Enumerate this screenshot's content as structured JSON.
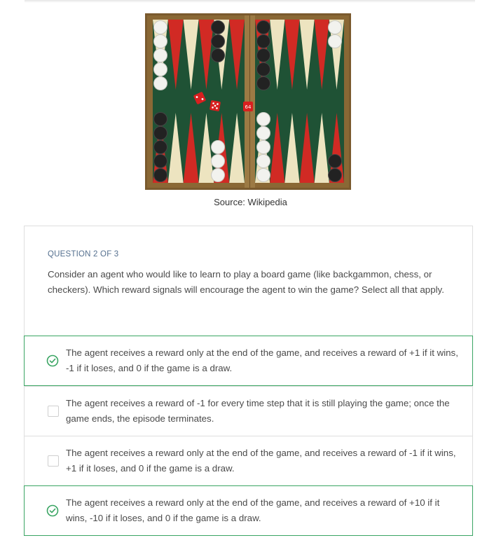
{
  "image": {
    "caption": "Source: Wikipedia",
    "doubling_cube_value": "64",
    "colors": {
      "frame": "#7a5a2e",
      "felt": "#1f5235",
      "red_point": "#d12a24",
      "cream_point": "#ede4c0",
      "dice": "#d81f1f"
    }
  },
  "question": {
    "header": "QUESTION 2 OF 3",
    "text": "Consider an agent who would like to learn to play a board game (like backgammon, chess, or checkers). Which reward signals will encourage the agent to win the game? Select all that apply."
  },
  "options": [
    {
      "text": "The agent receives a reward only at the end of the game, and receives a reward of +1 if it wins, -1 if it loses, and 0 if the game is a draw.",
      "selected": true
    },
    {
      "text": "The agent receives a reward of -1 for every time step that it is still playing the game; once the game ends, the episode terminates.",
      "selected": false
    },
    {
      "text": "The agent receives a reward only at the end of the game, and receives a reward of -1 if it wins, +1 if it loses, and 0 if the game is a draw.",
      "selected": false
    },
    {
      "text": "The agent receives a reward only at the end of the game, and receives a reward of +10 if it wins, -10 if it loses, and 0 if the game is a draw.",
      "selected": true
    }
  ],
  "colors": {
    "accent_green": "#3aa563",
    "header_blue": "#55708f"
  }
}
